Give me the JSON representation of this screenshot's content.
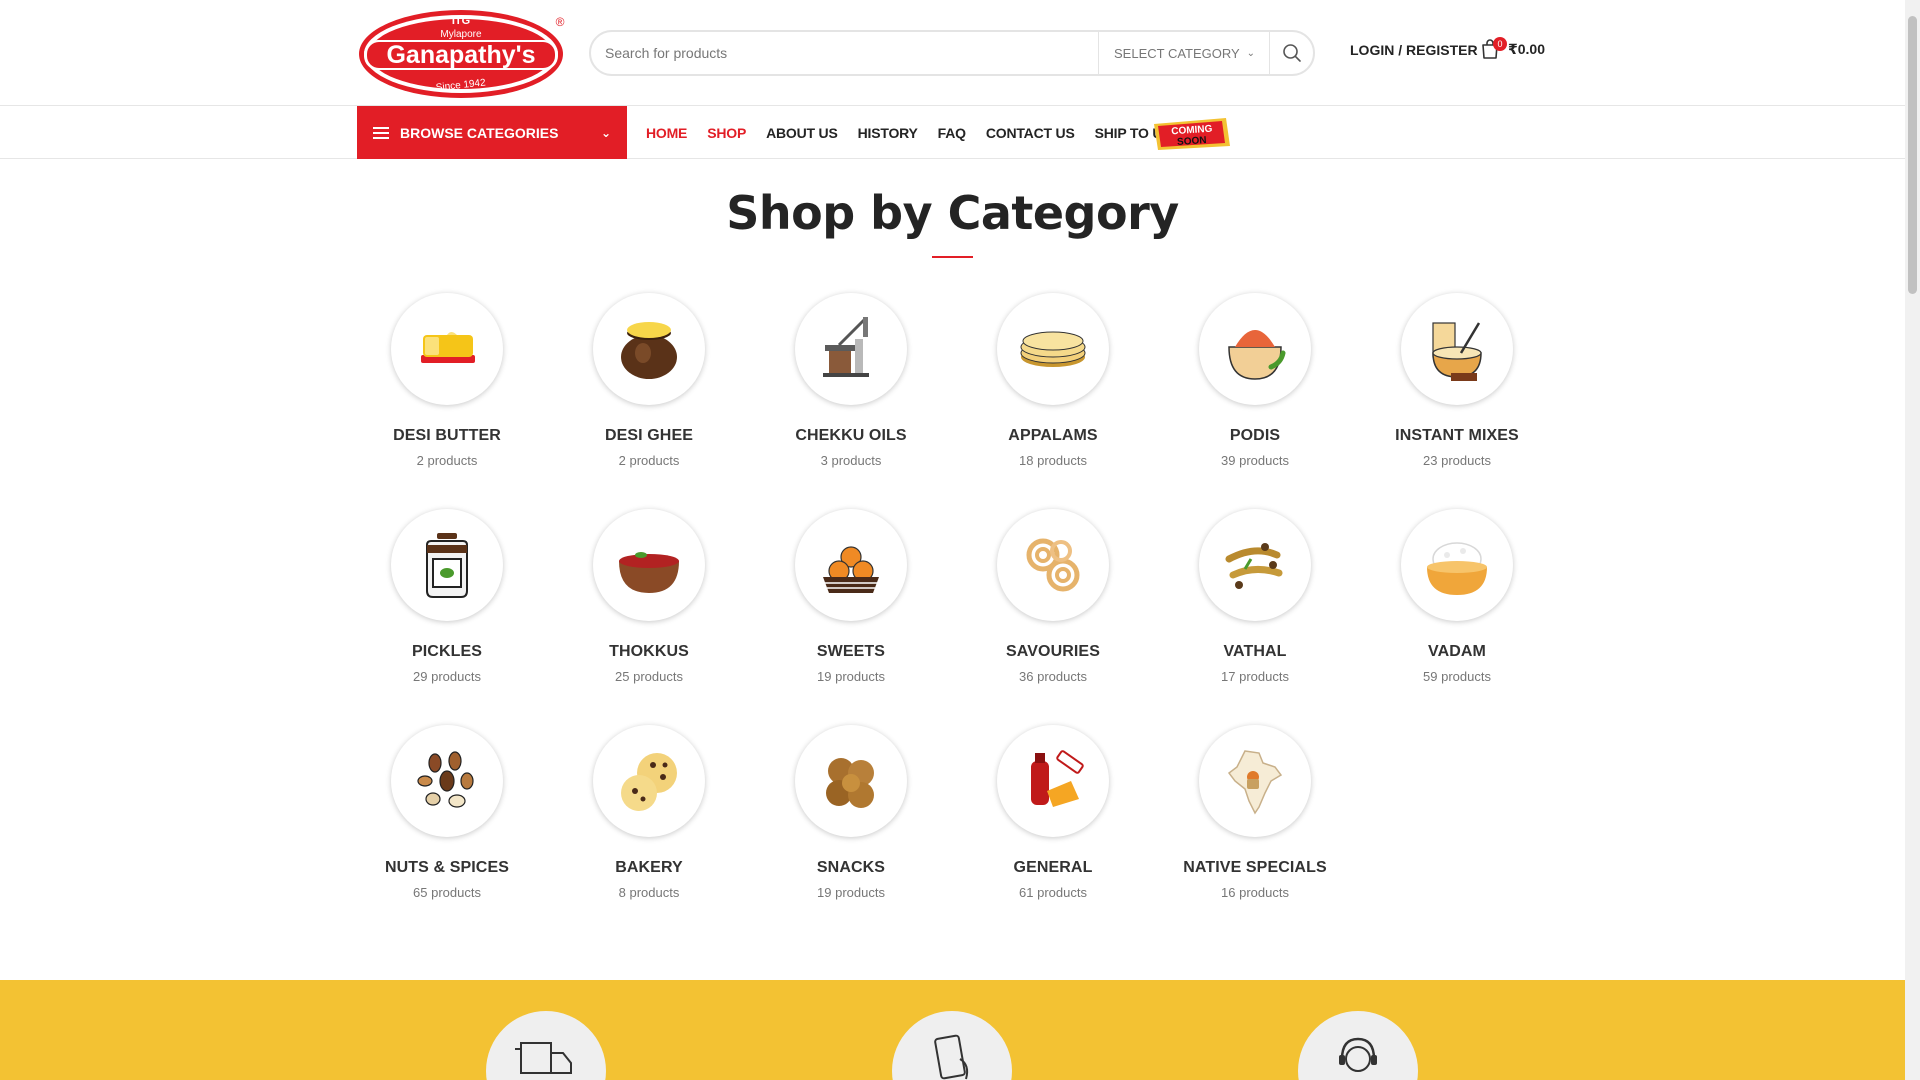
{
  "brand": {
    "name": "Ganapathy's",
    "prefix": "Mylapore",
    "since": "Since 1942",
    "emblem": "ITG",
    "registered": "®"
  },
  "header": {
    "search_placeholder": "Search for products",
    "category_select": "SELECT CATEGORY",
    "login_label": "LOGIN / REGISTER",
    "cart_count": "0",
    "cart_total": "₹0.00"
  },
  "nav": {
    "browse_label": "BROWSE CATEGORIES",
    "items": [
      {
        "label": "HOME",
        "active": true
      },
      {
        "label": "SHOP",
        "active": true
      },
      {
        "label": "ABOUT US",
        "active": false
      },
      {
        "label": "HISTORY",
        "active": false
      },
      {
        "label": "FAQ",
        "active": false
      },
      {
        "label": "CONTACT US",
        "active": false
      },
      {
        "label": "SHIP TO USA",
        "active": false
      }
    ],
    "coming_soon": [
      "COMING",
      "SOON"
    ]
  },
  "main": {
    "title": "Shop by Category",
    "categories": [
      {
        "name": "DESI BUTTER",
        "count": "2 products",
        "icon": "butter-icon"
      },
      {
        "name": "DESI GHEE",
        "count": "2 products",
        "icon": "ghee-pot-icon"
      },
      {
        "name": "CHEKKU OILS",
        "count": "3 products",
        "icon": "oil-press-icon"
      },
      {
        "name": "APPALAMS",
        "count": "18 products",
        "icon": "appalam-stack-icon"
      },
      {
        "name": "PODIS",
        "count": "39 products",
        "icon": "podi-sack-icon"
      },
      {
        "name": "INSTANT MIXES",
        "count": "23 products",
        "icon": "mixing-bowl-icon"
      },
      {
        "name": "PICKLES",
        "count": "29 products",
        "icon": "pickle-jar-icon"
      },
      {
        "name": "THOKKUS",
        "count": "25 products",
        "icon": "thokku-bowl-icon"
      },
      {
        "name": "SWEETS",
        "count": "19 products",
        "icon": "laddu-basket-icon"
      },
      {
        "name": "SAVOURIES",
        "count": "36 products",
        "icon": "murukku-icon"
      },
      {
        "name": "VATHAL",
        "count": "17 products",
        "icon": "dried-vathal-icon"
      },
      {
        "name": "VADAM",
        "count": "59 products",
        "icon": "vadam-bowl-icon"
      },
      {
        "name": "NUTS & SPICES",
        "count": "65 products",
        "icon": "nuts-icon"
      },
      {
        "name": "BAKERY",
        "count": "8 products",
        "icon": "cookie-icon"
      },
      {
        "name": "SNACKS",
        "count": "19 products",
        "icon": "snack-cluster-icon"
      },
      {
        "name": "GENERAL",
        "count": "61 products",
        "icon": "general-goods-icon"
      },
      {
        "name": "NATIVE SPECIALS",
        "count": "16 products",
        "icon": "india-map-icon"
      }
    ]
  },
  "colors": {
    "brand_red": "#e21e26",
    "band_yellow": "#f3c233",
    "text_dark": "#242424",
    "text_muted": "#777777"
  }
}
